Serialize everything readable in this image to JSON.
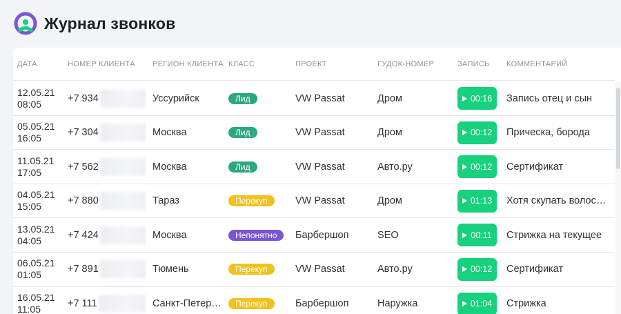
{
  "header": {
    "title": "Журнал звонков",
    "logo_icon": "brand-logo-icon",
    "logo_colors": [
      "#7a55d8",
      "#17d17d"
    ]
  },
  "table": {
    "columns": {
      "date": "Дата",
      "phone": "Номер клиента",
      "region": "Регион клиента",
      "class": "Класс",
      "project": "Проект",
      "gudok": "Гудок-номер",
      "record": "Запись",
      "comment": "Комментарий"
    },
    "rows": [
      {
        "date": "12.05.21",
        "time": "08:05",
        "phone": "+7 934",
        "region": "Уссурийск",
        "class": "Лид",
        "class_kind": "lead",
        "project": "VW Passat",
        "gudok": "Дром",
        "duration": "00:16",
        "comment": "Запись отец и сын"
      },
      {
        "date": "05.05.21",
        "time": "16:05",
        "phone": "+7 304",
        "region": "Москва",
        "class": "Лид",
        "class_kind": "lead",
        "project": "VW Passat",
        "gudok": "Дром",
        "duration": "00:12",
        "comment": "Прическа, борода"
      },
      {
        "date": "11.05.21",
        "time": "17:05",
        "phone": "+7 562",
        "region": "Москва",
        "class": "Лид",
        "class_kind": "lead",
        "project": "VW Passat",
        "gudok": "Авто.ру",
        "duration": "00:12",
        "comment": "Сертификат"
      },
      {
        "date": "04.05.21",
        "time": "15:05",
        "phone": "+7 880",
        "region": "Тараз",
        "class": "Перекуп",
        "class_kind": "perekup",
        "project": "VW Passat",
        "gudok": "Дром",
        "duration": "01:13",
        "comment": "Хотя скупать волос…"
      },
      {
        "date": "13.05.21",
        "time": "04:05",
        "phone": "+7 424",
        "region": "Москва",
        "class": "Непонятно",
        "class_kind": "unclear",
        "project": "Барбершоп",
        "gudok": "SEO",
        "duration": "00:11",
        "comment": "Стрижка на текущее"
      },
      {
        "date": "06.05.21",
        "time": "01:05",
        "phone": "+7 891",
        "region": "Тюмень",
        "class": "Перекуп",
        "class_kind": "perekup",
        "project": "VW Passat",
        "gudok": "Авто.ру",
        "duration": "00:12",
        "comment": "Сертификат"
      },
      {
        "date": "16.05.21",
        "time": "11:05",
        "phone": "+7 111",
        "region": "Санкт-Петер…",
        "class": "Перекуп",
        "class_kind": "perekup",
        "project": "Барбершоп",
        "gudok": "Наружка",
        "duration": "01:04",
        "comment": "Стрижка"
      }
    ]
  },
  "colors": {
    "lead": "#2ca77f",
    "perekup": "#f0c21b",
    "unclear": "#7a55d8",
    "play": "#17d17d"
  }
}
